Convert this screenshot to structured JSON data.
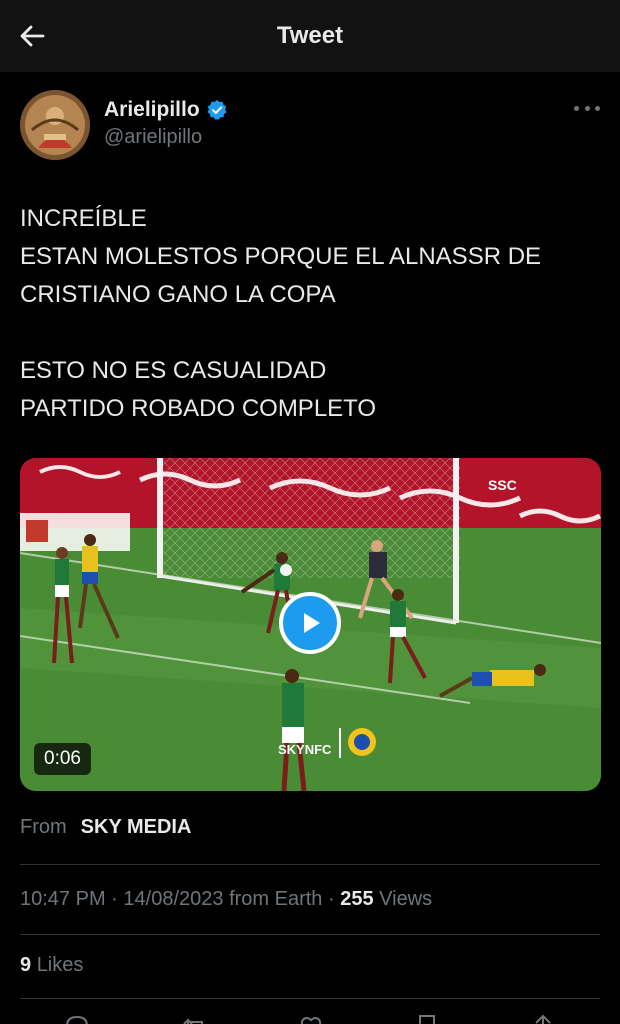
{
  "header": {
    "title": "Tweet",
    "back_icon": "arrow-left-icon"
  },
  "author": {
    "display_name": "Arielipillo",
    "handle": "@arielipillo",
    "verified": true,
    "verified_color": "#1d9bf0"
  },
  "tweet": {
    "lines": [
      "INCREÍBLE",
      "ESTAN MOLESTOS PORQUE EL ALNASSR DE",
      "CRISTIANO GANO LA COPA",
      "",
      "ESTO NO ES CASUALIDAD",
      "PARTIDO ROBADO COMPLETO"
    ]
  },
  "media": {
    "type": "video",
    "duration": "0:06",
    "overlay_brand": "SSC",
    "watermark_text": "SKYNFC",
    "play_color": "#1d9bf0"
  },
  "source": {
    "label": "From",
    "name": "SKY MEDIA"
  },
  "meta": {
    "time": "10:47 PM",
    "date": "14/08/2023",
    "origin": "from Earth",
    "views_count": "255",
    "views_label": "Views"
  },
  "engagement": {
    "likes_count": "9",
    "likes_label": "Likes"
  },
  "colors": {
    "background": "#000000",
    "header": "#121212",
    "muted": "#71767b",
    "accent": "#1d9bf0"
  }
}
